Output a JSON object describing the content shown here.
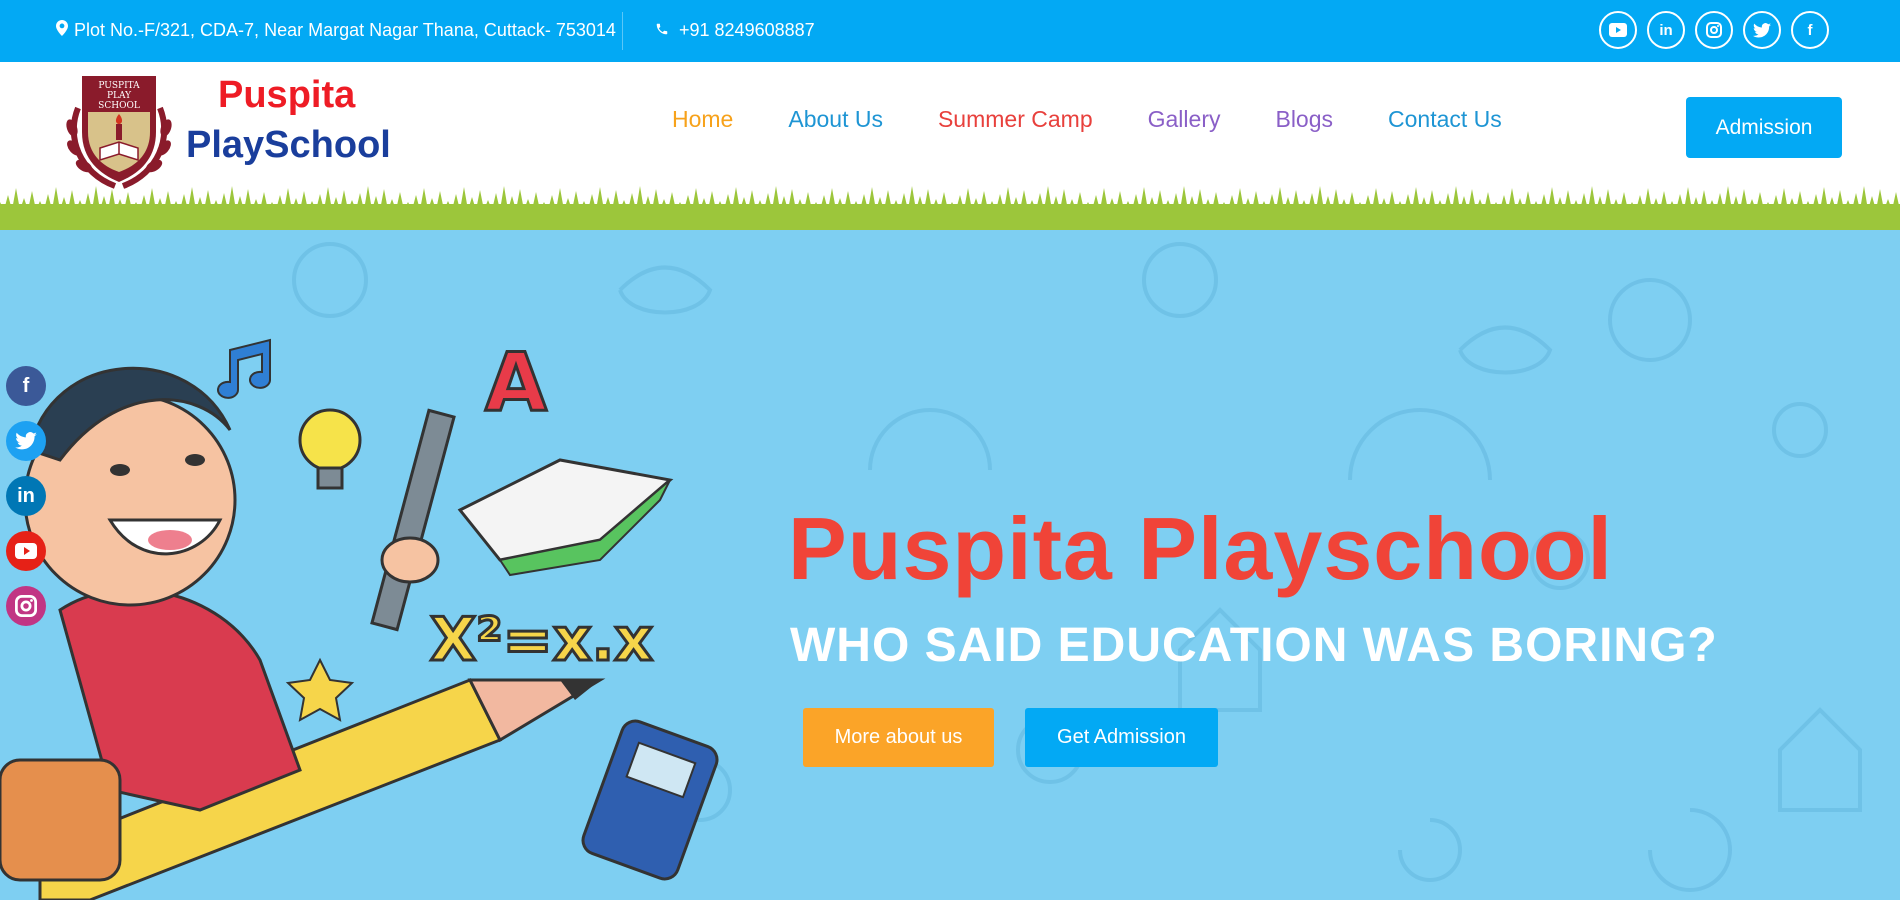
{
  "topbar": {
    "address": "Plot No.-F/321, CDA-7, Near Margat Nagar Thana, Cuttack- 753014",
    "phone": "+91 8249608887",
    "socials": [
      {
        "icon": "youtube-icon",
        "glyph": "▶"
      },
      {
        "icon": "linkedin-icon",
        "glyph": "in"
      },
      {
        "icon": "instagram-icon",
        "glyph": "◎"
      },
      {
        "icon": "twitter-icon",
        "glyph": "🐦"
      },
      {
        "icon": "facebook-icon",
        "glyph": "f"
      }
    ]
  },
  "brand": {
    "line1": "Puspita",
    "line2": "PlaySchool",
    "logo_text": "PUSPITA PLAY SCHOOL"
  },
  "nav": {
    "items": [
      {
        "label": "Home",
        "color": "#f7a21b"
      },
      {
        "label": "About Us",
        "color": "#1e95d4"
      },
      {
        "label": "Summer Camp",
        "color": "#e8403c"
      },
      {
        "label": "Gallery",
        "color": "#8a5fc7"
      },
      {
        "label": "Blogs",
        "color": "#8a5fc7"
      },
      {
        "label": "Contact Us",
        "color": "#1e95d4"
      }
    ],
    "admission_label": "Admission"
  },
  "hero": {
    "title": "Puspita Playschool",
    "subtitle": "WHO SAID EDUCATION WAS BORING?",
    "btn_more": "More about us",
    "btn_get": "Get Admission"
  },
  "float_socials": [
    {
      "icon": "facebook-icon",
      "glyph": "f",
      "color": "#3b5998"
    },
    {
      "icon": "twitter-icon",
      "glyph": "t",
      "color": "#1da1f2"
    },
    {
      "icon": "linkedin-icon",
      "glyph": "in",
      "color": "#0077b5"
    },
    {
      "icon": "youtube-icon",
      "glyph": "▶",
      "color": "#e62117"
    },
    {
      "icon": "instagram-icon",
      "glyph": "◎",
      "color": "#c13584"
    }
  ],
  "colors": {
    "primary": "#03a9f4",
    "accent": "#fba428",
    "title_red": "#f04438",
    "hero_bg": "#7ecff2"
  }
}
